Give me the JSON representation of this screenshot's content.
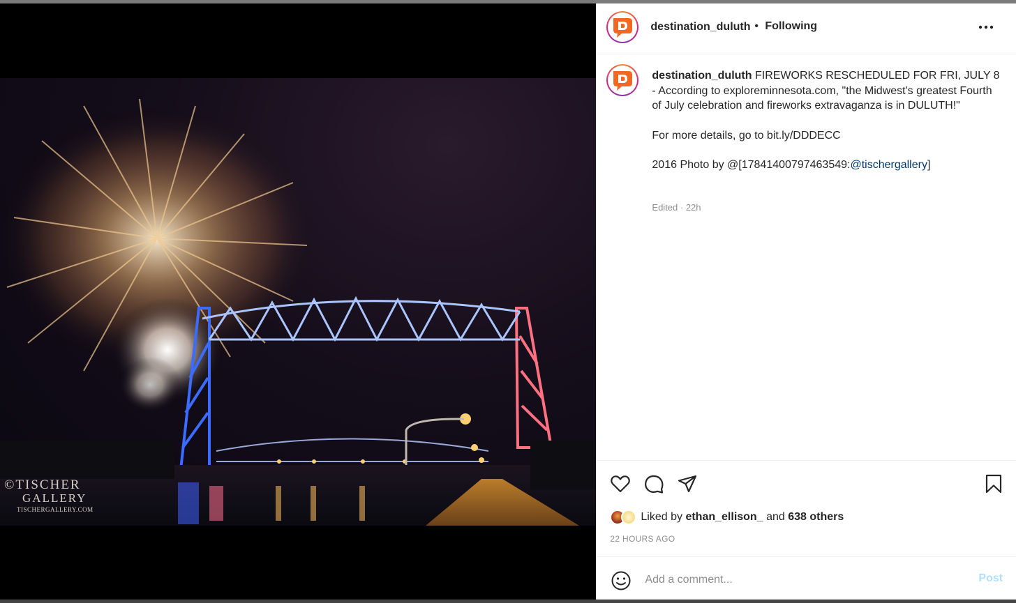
{
  "post": {
    "username": "destination_duluth",
    "separator": "•",
    "follow_status": "Following",
    "caption": {
      "username": "destination_duluth",
      "line1": "FIREWORKS RESCHEDULED FOR FRI, JULY 8 - According to exploreminnesota.com, \"the Midwest's greatest Fourth of July celebration and fireworks extravaganza is in DULUTH!\"",
      "line2": "For more details, go to bit.ly/DDDECC",
      "line3_prefix": "2016 Photo by @[17841400797463549:",
      "line3_mention": "@tischergallery",
      "line3_suffix": "]"
    },
    "meta": "Edited · 22h",
    "liked_prefix": "Liked by",
    "liked_user": "ethan_ellison_",
    "liked_and": "and",
    "liked_others": "638 others",
    "timestamp": "22 HOURS AGO",
    "comment_placeholder": "Add a comment...",
    "post_label": "Post"
  },
  "photo": {
    "watermark_line1": "©TISCHER",
    "watermark_line2": "GALLERY",
    "watermark_line3": "TISCHERGALLERY.COM"
  },
  "icons": {
    "avatar": "brand-logo-icon",
    "more": "more-options-icon",
    "like": "heart-icon",
    "comment": "comment-icon",
    "share": "share-icon",
    "save": "bookmark-icon",
    "emoji": "emoji-icon"
  },
  "colors": {
    "accent_link": "#00376b",
    "post_disabled": "#b2dffc",
    "brand_orange": "#f26722"
  }
}
